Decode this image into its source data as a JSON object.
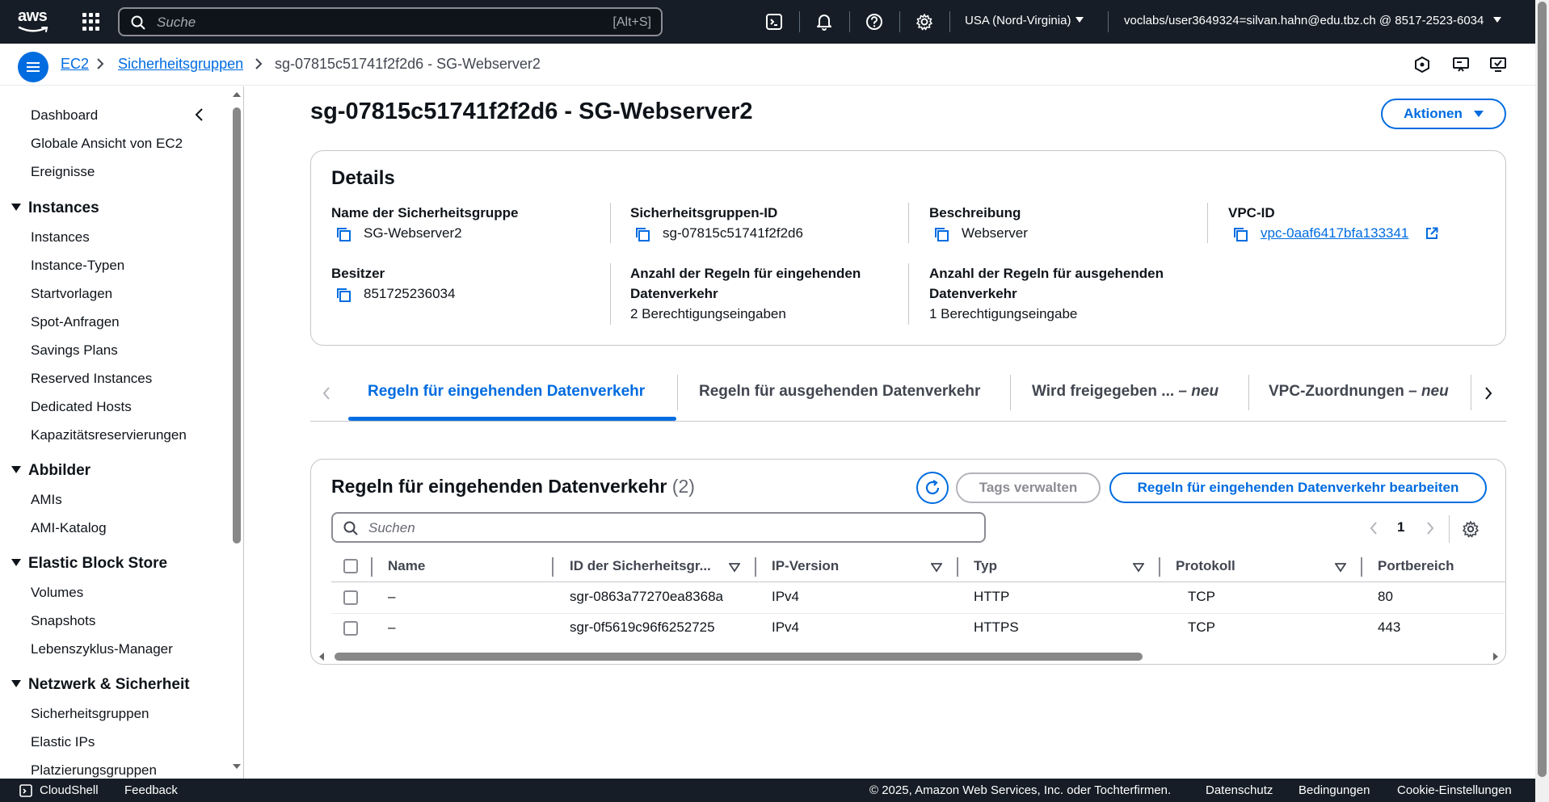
{
  "topbar": {
    "logo_text": "aws",
    "search_placeholder": "Suche",
    "search_shortcut": "[Alt+S]",
    "region": "USA (Nord-Virginia)",
    "account": "voclabs/user3649324=silvan.hahn@edu.tbz.ch @ 8517-2523-6034"
  },
  "breadcrumb": {
    "items": [
      "EC2",
      "Sicherheitsgruppen"
    ],
    "current": "sg-07815c51741f2f2d6 - SG-Webserver2"
  },
  "sidebar": {
    "top_items": [
      "Dashboard",
      "Globale Ansicht von EC2",
      "Ereignisse"
    ],
    "sections": [
      {
        "title": "Instances",
        "items": [
          "Instances",
          "Instance-Typen",
          "Startvorlagen",
          "Spot-Anfragen",
          "Savings Plans",
          "Reserved Instances",
          "Dedicated Hosts",
          "Kapazitätsreservierungen"
        ]
      },
      {
        "title": "Abbilder",
        "items": [
          "AMIs",
          "AMI-Katalog"
        ]
      },
      {
        "title": "Elastic Block Store",
        "items": [
          "Volumes",
          "Snapshots",
          "Lebenszyklus-Manager"
        ]
      },
      {
        "title": "Netzwerk & Sicherheit",
        "items": [
          "Sicherheitsgruppen",
          "Elastic IPs",
          "Platzierungsgruppen"
        ]
      }
    ]
  },
  "page": {
    "title": "sg-07815c51741f2f2d6 - SG-Webserver2",
    "actions_label": "Aktionen"
  },
  "details": {
    "heading": "Details",
    "fields": {
      "name_label": "Name der Sicherheitsgruppe",
      "name_value": "SG-Webserver2",
      "id_label": "Sicherheitsgruppen-ID",
      "id_value": "sg-07815c51741f2f2d6",
      "desc_label": "Beschreibung",
      "desc_value": "Webserver",
      "vpc_label": "VPC-ID",
      "vpc_value": "vpc-0aaf6417bfa133341",
      "owner_label": "Besitzer",
      "owner_value": "851725236034",
      "inbound_label_1": "Anzahl der Regeln für eingehenden",
      "inbound_label_2": "Datenverkehr",
      "inbound_value": "2 Berechtigungseingaben",
      "outbound_label_1": "Anzahl der Regeln für ausgehenden",
      "outbound_label_2": "Datenverkehr",
      "outbound_value": "1 Berechtigungseingabe"
    }
  },
  "tabs": {
    "inbound": "Regeln für eingehenden Datenverkehr",
    "outbound": "Regeln für ausgehenden Datenverkehr",
    "shared": "Wird freigegeben ...",
    "vpc": "VPC-Zuordnungen",
    "new_suffix": "– neu"
  },
  "rules": {
    "heading": "Regeln für eingehenden Datenverkehr",
    "count": "(2)",
    "manage_tags": "Tags verwalten",
    "edit_rules": "Regeln für eingehenden Datenverkehr bearbeiten",
    "search_placeholder": "Suchen",
    "page_number": "1",
    "columns": [
      "Name",
      "ID der Sicherheitsgr...",
      "IP-Version",
      "Typ",
      "Protokoll",
      "Portbereich"
    ],
    "rows": [
      {
        "name": "–",
        "id": "sgr-0863a77270ea8368a",
        "ip": "IPv4",
        "type": "HTTP",
        "protocol": "TCP",
        "port": "80"
      },
      {
        "name": "–",
        "id": "sgr-0f5619c96f6252725",
        "ip": "IPv4",
        "type": "HTTPS",
        "protocol": "TCP",
        "port": "443"
      }
    ]
  },
  "footer": {
    "cloudshell": "CloudShell",
    "feedback": "Feedback",
    "copyright": "© 2025, Amazon Web Services, Inc. oder Tochterfirmen.",
    "privacy": "Datenschutz",
    "terms": "Bedingungen",
    "cookies": "Cookie-Einstellungen"
  },
  "colors": {
    "topbar": "#161d26",
    "link_blue": "#006ce0",
    "border": "#c6c6cd"
  }
}
